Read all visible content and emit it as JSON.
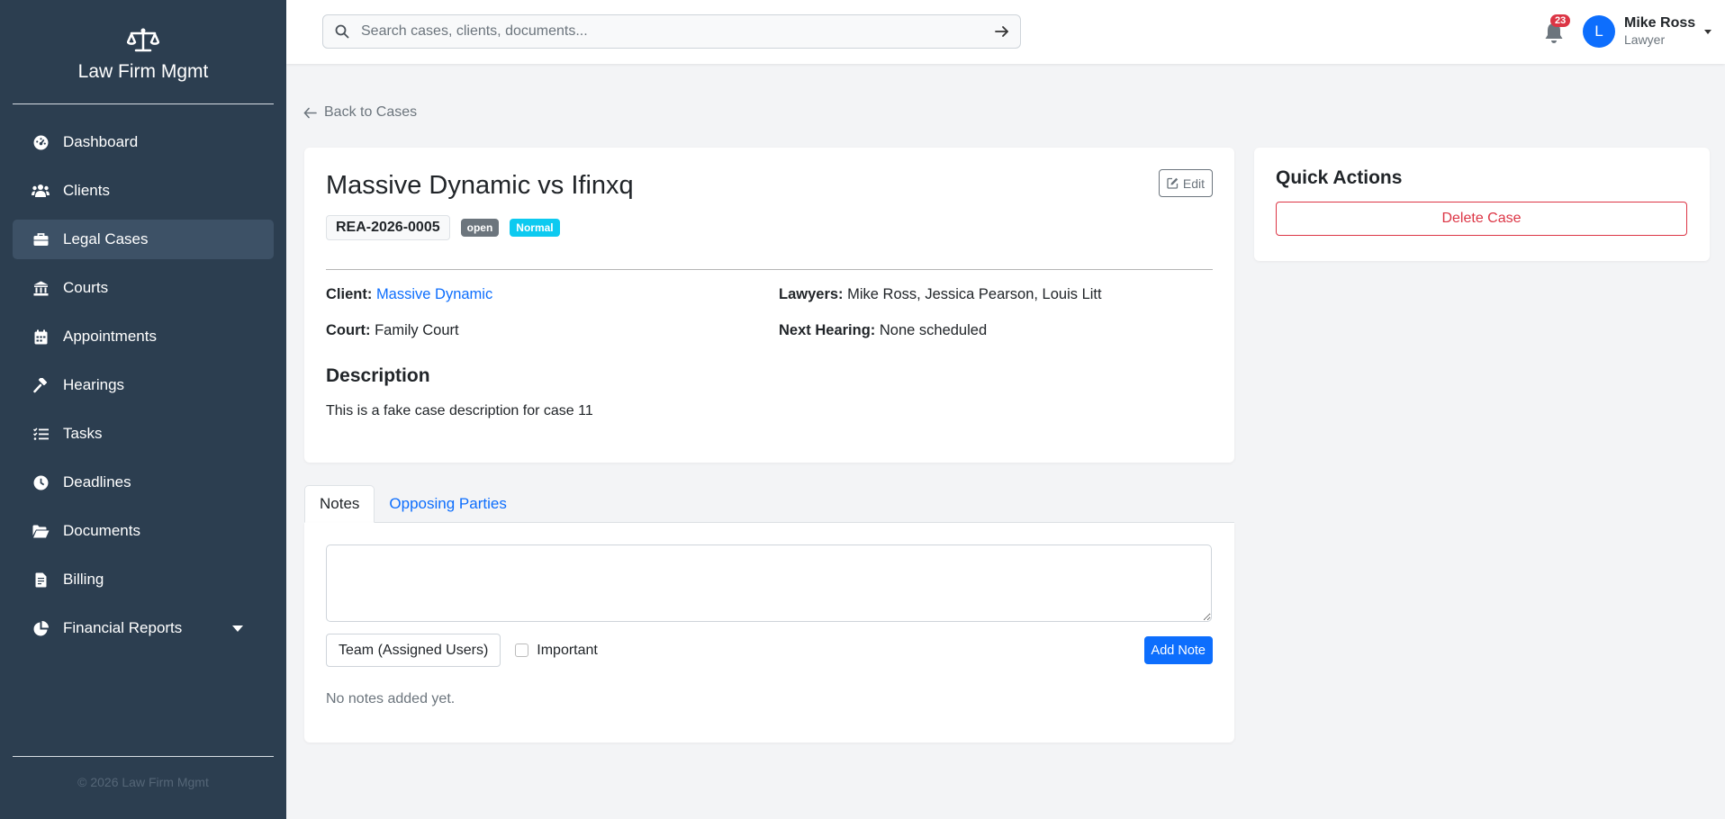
{
  "sidebar": {
    "brand": "Law Firm Mgmt",
    "items": [
      {
        "label": "Dashboard",
        "icon": "dashboard-icon"
      },
      {
        "label": "Clients",
        "icon": "users-icon"
      },
      {
        "label": "Legal Cases",
        "icon": "briefcase-icon",
        "active": true
      },
      {
        "label": "Courts",
        "icon": "courthouse-icon"
      },
      {
        "label": "Appointments",
        "icon": "calendar-icon"
      },
      {
        "label": "Hearings",
        "icon": "gavel-icon"
      },
      {
        "label": "Tasks",
        "icon": "tasks-icon"
      },
      {
        "label": "Deadlines",
        "icon": "clock-icon"
      },
      {
        "label": "Documents",
        "icon": "folder-icon"
      },
      {
        "label": "Billing",
        "icon": "invoice-icon"
      },
      {
        "label": "Financial Reports",
        "icon": "pie-chart-icon",
        "has_dropdown": true
      }
    ],
    "footer": "© 2026 Law Firm Mgmt"
  },
  "header": {
    "search_placeholder": "Search cases, clients, documents...",
    "notification_count": "23",
    "user": {
      "initial": "L",
      "name": "Mike Ross",
      "role": "Lawyer"
    }
  },
  "main": {
    "back_link": "Back to Cases",
    "case": {
      "title": "Massive Dynamic vs Ifinxq",
      "edit_label": "Edit",
      "case_number": "REA-2026-0005",
      "status": "open",
      "priority": "Normal",
      "client_label": "Client:",
      "client": "Massive Dynamic",
      "lawyers_label": "Lawyers:",
      "lawyers": "Mike Ross, Jessica Pearson, Louis Litt",
      "court_label": "Court:",
      "court": "Family Court",
      "hearing_label": "Next Hearing:",
      "hearing": "None scheduled",
      "description_title": "Description",
      "description": "This is a fake case description for case 11"
    },
    "quick_actions": {
      "title": "Quick Actions",
      "delete_label": "Delete Case"
    },
    "tabs": [
      "Notes",
      "Opposing Parties"
    ],
    "notes": {
      "note_text": "",
      "visibility": "Team (Assigned Users)",
      "important_label": "Important",
      "important_checked": false,
      "add_label": "Add Note",
      "empty_text": "No notes added yet."
    }
  },
  "colors": {
    "sidebar_bg": "#2c3e50",
    "primary": "#0d6efd",
    "danger": "#dc3545",
    "badge_open": "#6c757d",
    "badge_normal": "#0dcaf0"
  }
}
